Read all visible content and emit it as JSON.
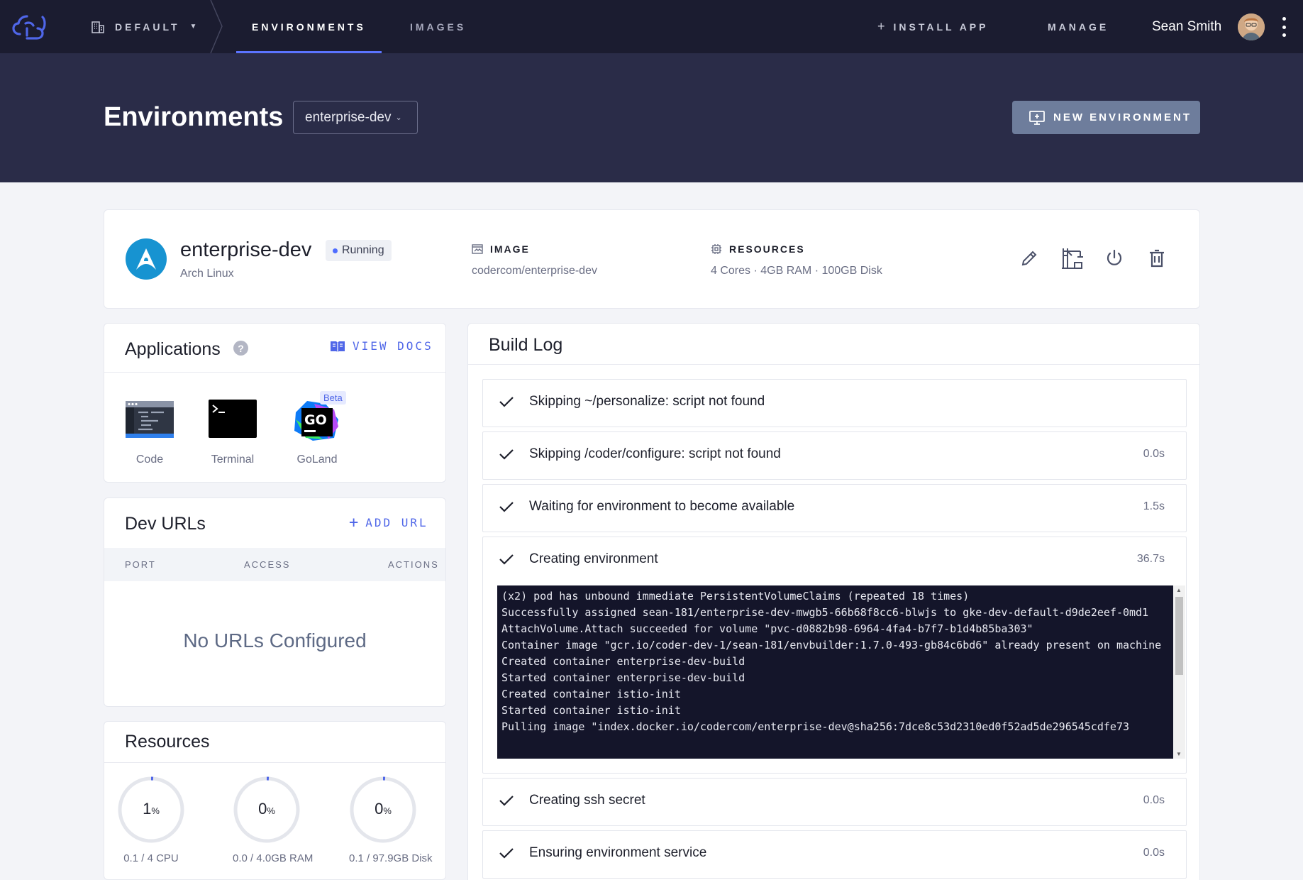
{
  "nav": {
    "org": "DEFAULT",
    "tabs": [
      {
        "label": "ENVIRONMENTS",
        "active": true
      },
      {
        "label": "IMAGES",
        "active": false
      }
    ],
    "install_app": "INSTALL APP",
    "manage": "MANAGE",
    "user_name": "Sean Smith",
    "accent": "#5b74ff"
  },
  "header": {
    "title": "Environments",
    "env_select": "enterprise-dev",
    "new_env_button": "NEW ENVIRONMENT"
  },
  "summary": {
    "name": "enterprise-dev",
    "status": "Running",
    "os": "Arch Linux",
    "image_label": "IMAGE",
    "image_value": "codercom/enterprise-dev",
    "resources_label": "RESOURCES",
    "resources_value": "4 Cores · 4GB RAM · 100GB Disk",
    "actions": [
      "edit-icon",
      "build-icon",
      "power-icon",
      "trash-icon"
    ]
  },
  "applications": {
    "title": "Applications",
    "view_docs": "VIEW DOCS",
    "apps": [
      {
        "label": "Code",
        "icon": "code-app-icon"
      },
      {
        "label": "Terminal",
        "icon": "terminal-app-icon"
      },
      {
        "label": "GoLand",
        "icon": "goland-app-icon",
        "badge": "Beta"
      }
    ]
  },
  "dev_urls": {
    "title": "Dev URLs",
    "add_url": "ADD URL",
    "columns": [
      "PORT",
      "ACCESS",
      "ACTIONS"
    ],
    "empty_message": "No URLs Configured"
  },
  "resources": {
    "title": "Resources",
    "gauges": [
      {
        "value": "1",
        "unit": "%",
        "fraction": 0.01,
        "label": "0.1 / 4 CPU"
      },
      {
        "value": "0",
        "unit": "%",
        "fraction": 0.0,
        "label": "0.0 / 4.0GB RAM"
      },
      {
        "value": "0",
        "unit": "%",
        "fraction": 0.0,
        "label": "0.1 / 97.9GB Disk"
      }
    ]
  },
  "build_log": {
    "title": "Build Log",
    "steps": [
      {
        "text": "Skipping ~/personalize: script not found",
        "time": ""
      },
      {
        "text": "Skipping /coder/configure: script not found",
        "time": "0.0s"
      },
      {
        "text": "Waiting for environment to become available",
        "time": "1.5s"
      },
      {
        "text": "Creating environment",
        "time": "36.7s"
      },
      {
        "text": "Creating ssh secret",
        "time": "0.0s"
      },
      {
        "text": "Ensuring environment service",
        "time": "0.0s"
      }
    ],
    "terminal_output": "(x2) pod has unbound immediate PersistentVolumeClaims (repeated 18 times)\nSuccessfully assigned sean-181/enterprise-dev-mwgb5-66b68f8cc6-blwjs to gke-dev-default-d9de2eef-0md1\nAttachVolume.Attach succeeded for volume \"pvc-d0882b98-6964-4fa4-b7f7-b1d4b85ba303\"\nContainer image \"gcr.io/coder-dev-1/sean-181/envbuilder:1.7.0-493-gb84c6bd6\" already present on machine\nCreated container enterprise-dev-build\nStarted container enterprise-dev-build\nCreated container istio-init\nStarted container istio-init\nPulling image \"index.docker.io/codercom/enterprise-dev@sha256:7dce8c53d2310ed0f52ad5de296545cdfe73"
  }
}
